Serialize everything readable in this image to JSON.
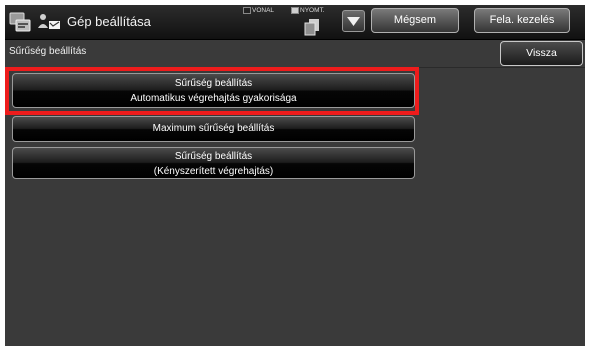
{
  "header": {
    "title": "Gép beállítása",
    "indicator_line": "VONAL",
    "indicator_print": "NYOMT.",
    "cancel_label": "Mégsem",
    "jobs_label": "Fela. kezelés"
  },
  "subheader": {
    "breadcrumb": "Sűrűség beállítás",
    "back_label": "Vissza"
  },
  "menu": {
    "items": [
      {
        "line1": "Sűrűség beállítás",
        "line2": "Automatikus végrehajtás gyakorisága",
        "highlighted": true
      },
      {
        "line1": "Maximum sűrűség beállítás"
      },
      {
        "line1": "Sűrűség beállítás",
        "line2": "(Kényszerített végrehajtás)"
      }
    ]
  },
  "colors": {
    "highlight": "#ee1c1c",
    "background": "#3a3a3a",
    "topbar": "#111111"
  },
  "icons": {
    "app": "machine-settings-icon",
    "user": "user-settings-icon",
    "document": "document-stack-icon",
    "dropdown": "triangle-down-icon"
  }
}
